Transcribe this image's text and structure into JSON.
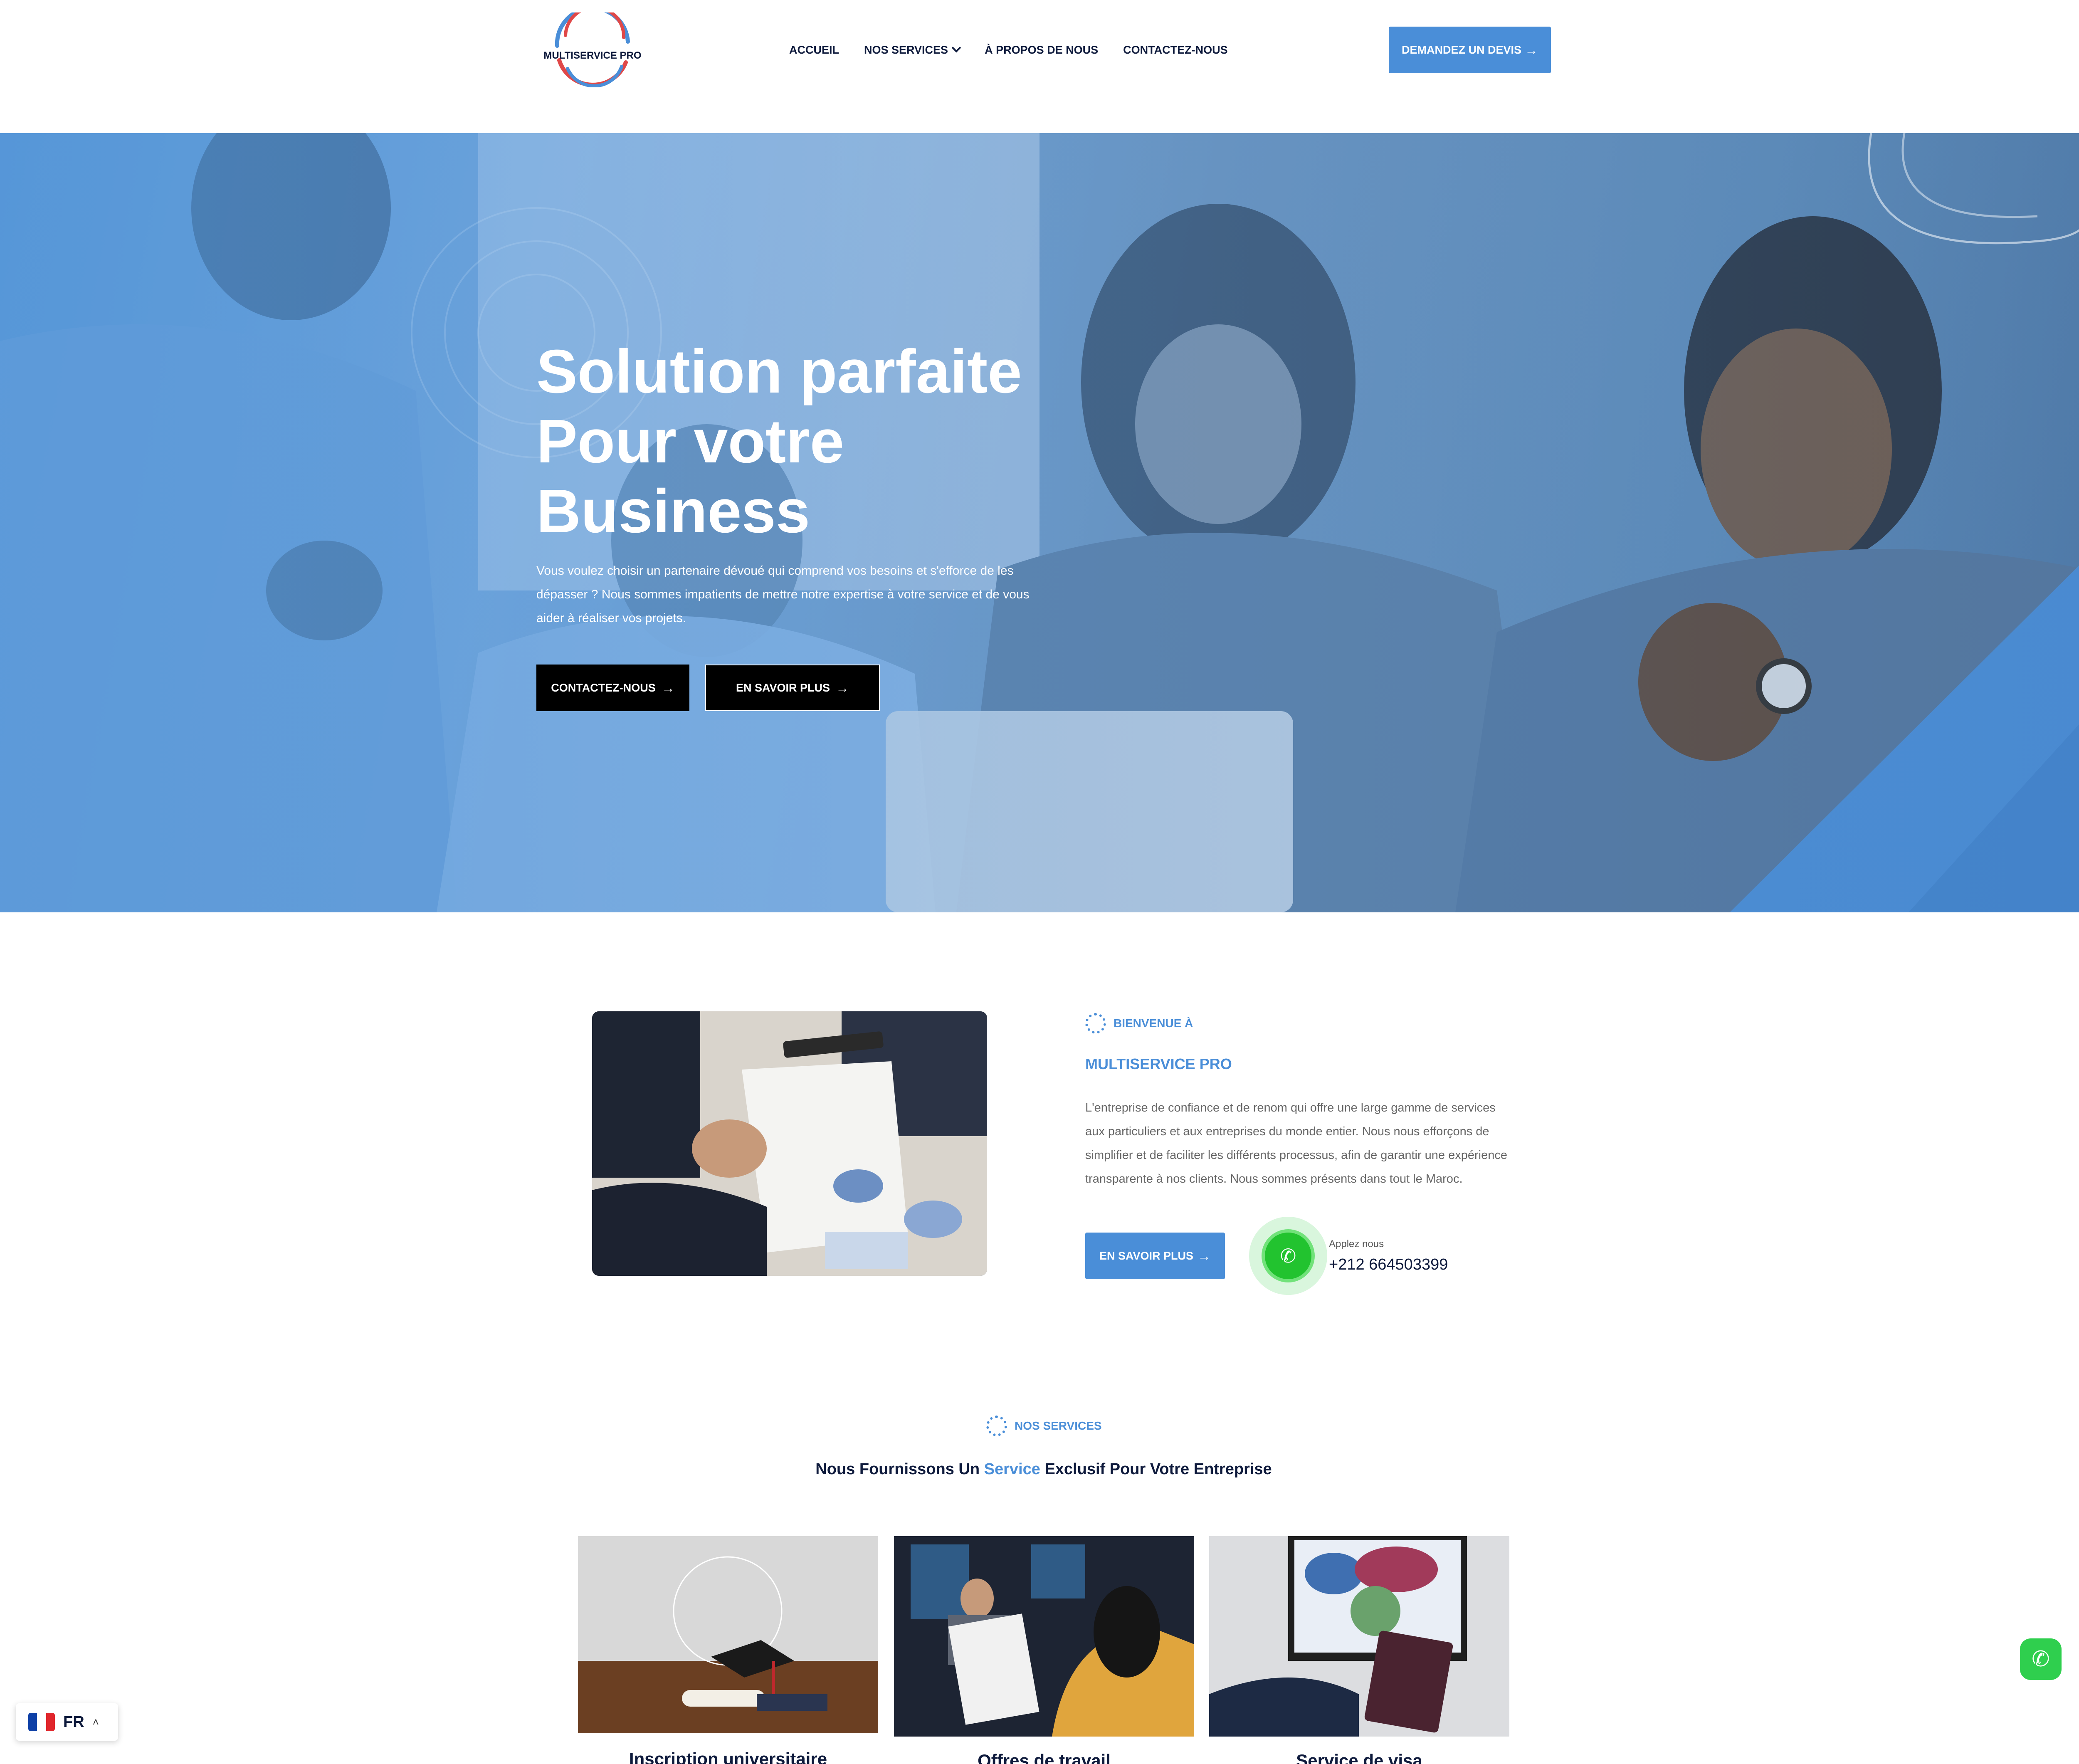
{
  "header": {
    "logo_text": "MULTISERVICE PRO",
    "nav": [
      {
        "label": "ACCUEIL"
      },
      {
        "label": "NOS SERVICES",
        "has_dropdown": true
      },
      {
        "label": "À PROPOS DE NOUS"
      },
      {
        "label": "CONTACTEZ-NOUS"
      }
    ],
    "quote_button": "DEMANDEZ UN DEVIS"
  },
  "hero": {
    "title_line1": "Solution parfaite",
    "title_line2": "Pour votre",
    "title_line3": "Business",
    "text": "Vous voulez choisir un partenaire dévoué qui comprend vos besoins et s'efforce de les dépasser ? Nous sommes impatients de mettre notre expertise à votre service et de vous aider à réaliser vos projets.",
    "btn_contact": "CONTACTEZ-NOUS",
    "btn_more": "EN SAVOIR PLUS"
  },
  "about": {
    "tag": "BIENVENUE À",
    "title": "MULTISERVICE PRO",
    "text": "L'entreprise de confiance et de renom qui offre une large gamme de services aux particuliers et aux entreprises du monde entier. Nous nous efforçons de simplifier et de faciliter les différents processus, afin de garantir une expérience transparente à nos clients. Nous sommes présents dans tout le Maroc.",
    "button": "EN SAVOIR PLUS",
    "call_label": "Applez nous",
    "call_number": "+212 664503399"
  },
  "services": {
    "tag": "NOS SERVICES",
    "heading_pre": "Nous Fournissons Un ",
    "heading_highlight": "Service",
    "heading_post": " Exclusif Pour Votre Entreprise",
    "cards": [
      {
        "title": "Inscription universitaire"
      },
      {
        "title": "Offres de travail"
      },
      {
        "title": "Service de visa"
      }
    ]
  },
  "language": {
    "code": "FR"
  },
  "colors": {
    "accent": "#4a8ed8",
    "dark": "#0e1a3c",
    "whatsapp": "#2fcf4e"
  }
}
